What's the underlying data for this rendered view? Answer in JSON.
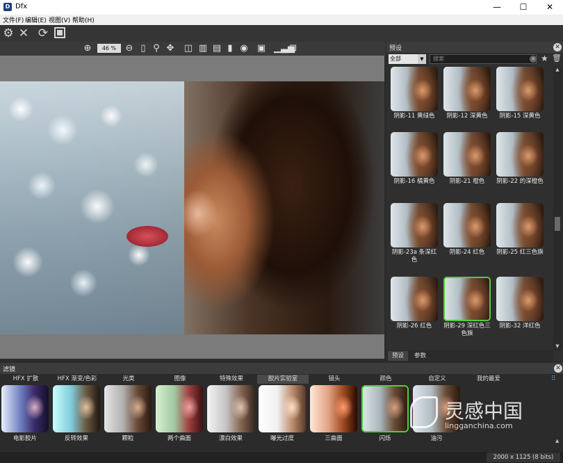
{
  "window": {
    "title": "Dfx",
    "icon_letter": "D",
    "controls": {
      "minimize": "—",
      "maximize": "☐",
      "close": "✕"
    }
  },
  "menu": [
    "文件(F)",
    "编辑(E)",
    "视图(V)",
    "帮助(H)"
  ],
  "toolbar": {
    "icons": [
      "gear-icon",
      "close-icon",
      "refresh-icon",
      "compare-icon"
    ]
  },
  "viewbar": {
    "zoom": "46 %",
    "icons": [
      "zoom-in-icon",
      "zoom-out-icon",
      "fit-icon",
      "magnifier-icon",
      "pan-icon",
      "split-view-icon",
      "split-view-2-icon",
      "split-horizontal-icon",
      "page-icon",
      "camera-icon",
      "crop-icon",
      "histogram-icon",
      "loupe-icon"
    ]
  },
  "presets": {
    "title": "预设",
    "category": "全部",
    "search_placeholder": "搜索",
    "tabs": [
      "预设",
      "参数"
    ],
    "items": [
      {
        "label": "阴影-11 黄绿色"
      },
      {
        "label": "阴影-12 深黄色"
      },
      {
        "label": "阴影-15 深黄色"
      },
      {
        "label": "阴影-16 橘黄色"
      },
      {
        "label": "阴影-21 橙色"
      },
      {
        "label": "阴影-22 的深橙色"
      },
      {
        "label": "阴影-23a 条深红色"
      },
      {
        "label": "阴影-24 红色"
      },
      {
        "label": "阴影-25 红三色旗"
      },
      {
        "label": "阴影-26 红色"
      },
      {
        "label": "阴影-29 深红色三色旗",
        "selected": true
      },
      {
        "label": "阴影-32 洋红色"
      }
    ]
  },
  "filters": {
    "title": "滤镜",
    "tabs": [
      "HFX 扩散",
      "HFX 渐变/色彩",
      "光类",
      "图像",
      "特殊效果",
      "胶片实验室",
      "镜头",
      "颜色",
      "自定义",
      "我的最爱"
    ],
    "active_tab": 5,
    "items": [
      {
        "label": "电影胶片"
      },
      {
        "label": "反转效果"
      },
      {
        "label": "颗粒"
      },
      {
        "label": "两个曲面"
      },
      {
        "label": "漂白效果"
      },
      {
        "label": "曝光过度"
      },
      {
        "label": "三曲面"
      },
      {
        "label": "闪烁",
        "selected": true
      },
      {
        "label": "油污"
      }
    ]
  },
  "watermark": {
    "cn": "灵感中国",
    "en": "lingganchina.com"
  },
  "status": {
    "dimensions": "2000 x 1125 (8 bits)"
  }
}
